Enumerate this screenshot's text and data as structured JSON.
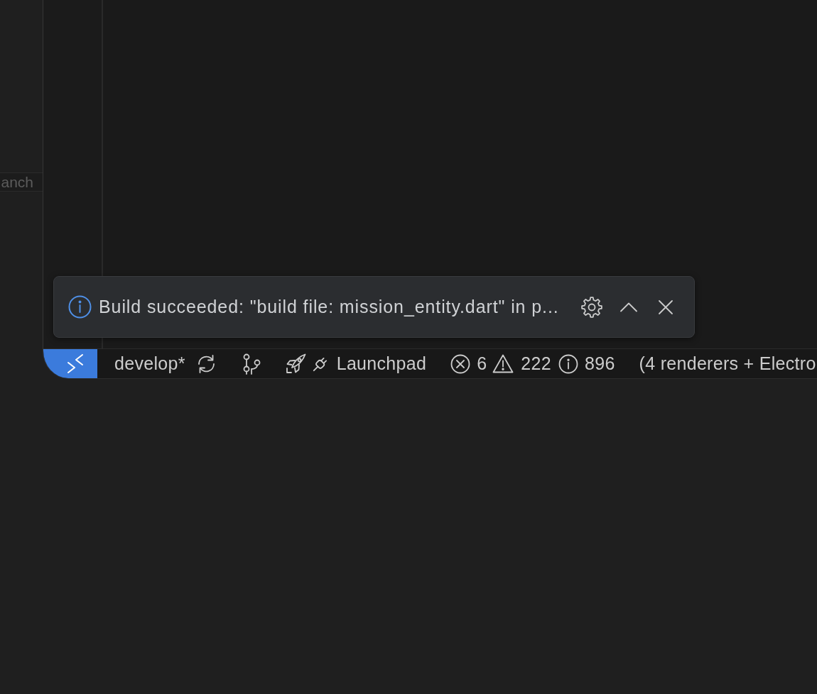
{
  "side_panel": {
    "button": "anch"
  },
  "notification": {
    "message": "Build succeeded: \"build file: mission_entity.dart\" in p..."
  },
  "status_bar": {
    "items": [
      {
        "kind": "remote"
      },
      {
        "kind": "branch",
        "label": "develop*"
      },
      {
        "kind": "graph"
      },
      {
        "kind": "launchpad",
        "label": "Launchpad"
      },
      {
        "kind": "problems",
        "errors": "6",
        "warnings": "222",
        "infos": "896"
      },
      {
        "kind": "text",
        "label": "(4 renderers + Electro"
      }
    ]
  }
}
